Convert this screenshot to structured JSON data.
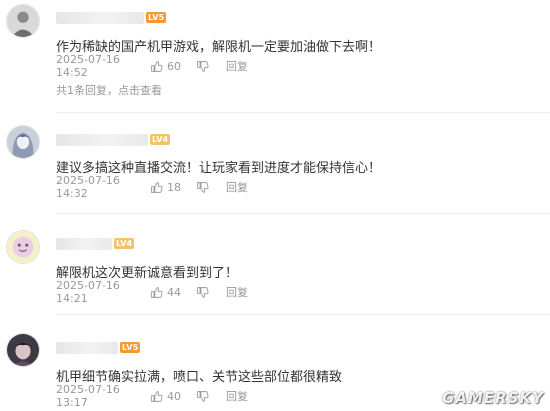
{
  "comments": [
    {
      "text": "作为稀缺的国产机甲游戏，解限机一定要加油做下去啊！",
      "time": "2025-07-16 14:52",
      "likes": "60",
      "reply_label": "回复",
      "thread_text": "共1条回复，点击查看",
      "level": "LV5",
      "level_color": "#f39a32"
    },
    {
      "text": "建议多搞这种直播交流！让玩家看到进度才能保持信心！",
      "time": "2025-07-16 14:32",
      "likes": "18",
      "reply_label": "回复",
      "level": "LV4",
      "level_color": "#f2c36b"
    },
    {
      "text": "解限机这次更新诚意看到到了！",
      "time": "2025-07-16 14:21",
      "likes": "44",
      "reply_label": "回复",
      "level": "LV4",
      "level_color": "#f2c36b"
    },
    {
      "text": "机甲细节确实拉满，喷口、关节这些部位都很精致",
      "time": "2025-07-16 13:17",
      "likes": "40",
      "reply_label": "回复",
      "level": "LV5",
      "level_color": "#f39a32"
    }
  ],
  "icons": {
    "like": "thumbs-up-icon",
    "dislike": "thumbs-down-icon"
  },
  "watermark": "GAMERSKY"
}
